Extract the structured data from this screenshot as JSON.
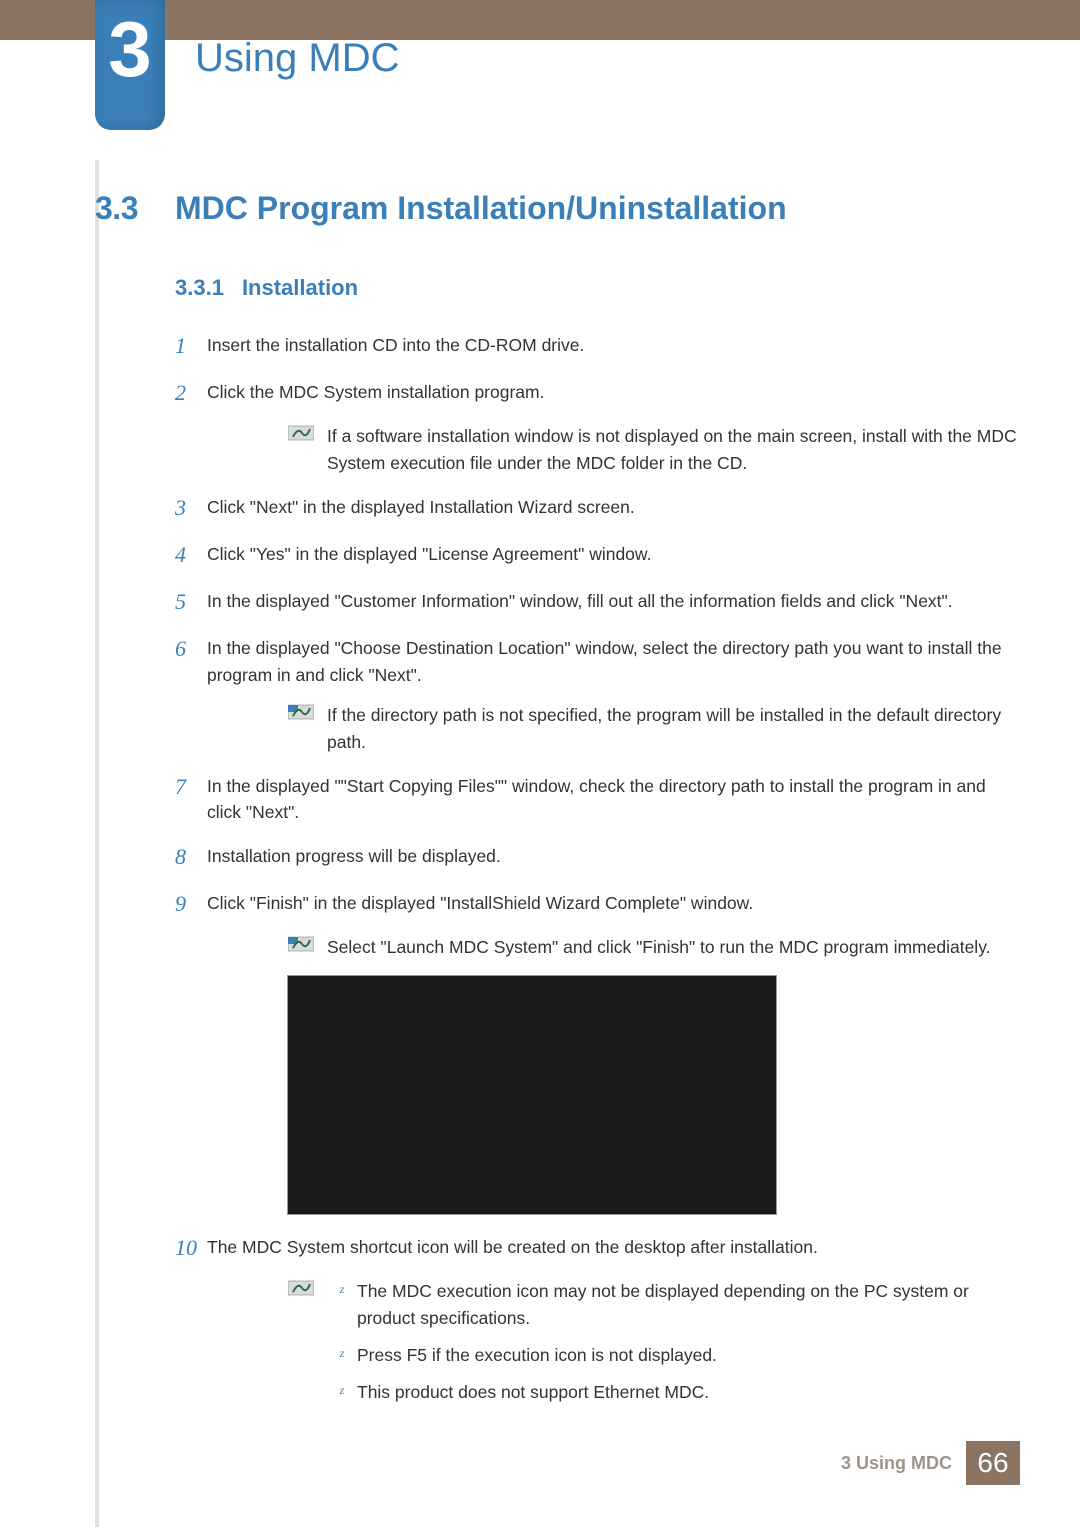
{
  "chapter": {
    "number": "3",
    "title": "Using MDC"
  },
  "section": {
    "number": "3.3",
    "title": "MDC Program Installation/Uninstallation"
  },
  "subsection": {
    "number": "3.3.1",
    "title": "Installation"
  },
  "steps": {
    "s1": {
      "num": "1",
      "text": "Insert the installation CD into the CD-ROM drive."
    },
    "s2": {
      "num": "2",
      "text": "Click the MDC System installation program."
    },
    "note_after_2": "If a software installation window is not displayed on the main screen, install with the MDC System execution file under the MDC folder in the CD.",
    "s3": {
      "num": "3",
      "text": "Click \"Next\" in the displayed Installation Wizard screen."
    },
    "s4": {
      "num": "4",
      "text": "Click \"Yes\" in the displayed \"License Agreement\" window."
    },
    "s5": {
      "num": "5",
      "text": "In the displayed \"Customer Information\" window, fill out all the information fields and click \"Next\"."
    },
    "s6": {
      "num": "6",
      "text": "In the displayed \"Choose Destination Location\" window, select the directory path you want to install the program in and click \"Next\"."
    },
    "note_after_6": "If the directory path is not specified, the program will be installed in the default directory path.",
    "s7": {
      "num": "7",
      "text": "In the displayed \"\"Start Copying Files\"\" window, check the directory path to install the program in and click \"Next\"."
    },
    "s8": {
      "num": "8",
      "text": "Installation progress will be displayed."
    },
    "s9": {
      "num": "9",
      "text": "Click \"Finish\" in the displayed \"InstallShield Wizard Complete\" window."
    },
    "note_after_9": "Select \"Launch MDC System\" and click \"Finish\" to run the MDC program immediately.",
    "s10": {
      "num": "10",
      "text": "The MDC System shortcut icon will be created on the desktop after installation."
    },
    "note_after_10": {
      "b1": "The MDC execution icon may not be displayed depending on the PC system or product specifications.",
      "b2": "Press F5 if the execution icon is not displayed.",
      "b3": "This product does not support Ethernet MDC."
    }
  },
  "bullet_marks": {
    "z": "z"
  },
  "footer": {
    "label": "3 Using MDC",
    "page": "66"
  }
}
